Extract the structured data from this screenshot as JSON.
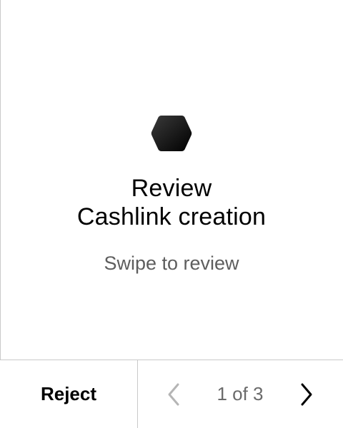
{
  "review": {
    "title_line1": "Review",
    "title_line2": "Cashlink creation",
    "hint": "Swipe to review",
    "icon": "hexagon-icon"
  },
  "footer": {
    "reject_label": "Reject",
    "page_indicator": "1 of 3",
    "prev_icon": "chevron-left-icon",
    "next_icon": "chevron-right-icon"
  },
  "colors": {
    "background": "#ffffff",
    "text": "#000000",
    "secondary_text": "#5e5e5e",
    "divider": "#c9c9c9",
    "disabled_icon": "#b5b5b5"
  }
}
